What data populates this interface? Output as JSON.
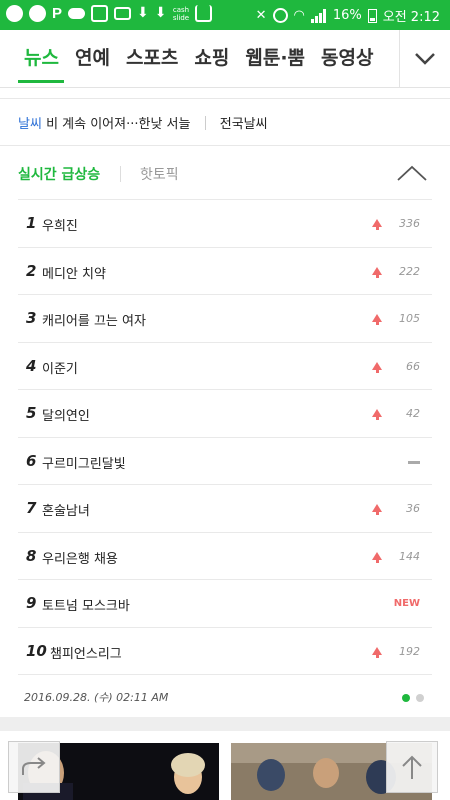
{
  "status_bar": {
    "battery": "16%",
    "time": "오전 2:12",
    "icons": [
      "chat-icon",
      "messenger-icon",
      "p-icon",
      "cloud-icon",
      "image-icon",
      "mail-icon",
      "download-icon",
      "download-icon",
      "cashslide-icon",
      "download-box-icon",
      "mute-icon",
      "alarm-icon",
      "wifi-icon",
      "signal-icon",
      "battery-icon"
    ],
    "cashslide_label": "cash slide"
  },
  "nav": {
    "tabs": [
      {
        "label": "뉴스",
        "active": true
      },
      {
        "label": "연예"
      },
      {
        "label": "스포츠"
      },
      {
        "label": "쇼핑"
      },
      {
        "label": "웹툰·뿜"
      },
      {
        "label": "동영상"
      }
    ],
    "more_icon": "chevron-down-icon",
    "accent": "#1fb83e"
  },
  "weather": {
    "label": "날씨",
    "text": "비 계속 이어져···한낮 서늘",
    "link": "전국날씨"
  },
  "realtime": {
    "tab_active": "실시간 급상승",
    "tab_other": "핫토픽",
    "collapse_icon": "chevron-up-icon",
    "items": [
      {
        "rank": "1",
        "keyword": "우희진",
        "trend": "up",
        "value": "336"
      },
      {
        "rank": "2",
        "keyword": "메디안 치약",
        "trend": "up",
        "value": "222"
      },
      {
        "rank": "3",
        "keyword": "캐리어를 끄는 여자",
        "trend": "up",
        "value": "105"
      },
      {
        "rank": "4",
        "keyword": "이준기",
        "trend": "up",
        "value": "66"
      },
      {
        "rank": "5",
        "keyword": "달의연인",
        "trend": "up",
        "value": "42"
      },
      {
        "rank": "6",
        "keyword": "구르미그린달빛",
        "trend": "same",
        "value": ""
      },
      {
        "rank": "7",
        "keyword": "혼술남녀",
        "trend": "up",
        "value": "36"
      },
      {
        "rank": "8",
        "keyword": "우리은행 채용",
        "trend": "up",
        "value": "144"
      },
      {
        "rank": "9",
        "keyword": "토트넘 모스크바",
        "trend": "new",
        "value": "NEW"
      },
      {
        "rank": "10",
        "keyword": "챔피언스리그",
        "trend": "up",
        "value": "192"
      }
    ],
    "timestamp": "2016.09.28. (수) 02:11 AM",
    "page_dots": 2,
    "active_dot": 1
  },
  "floating": {
    "share_icon": "share-arrow-icon",
    "top_icon": "scroll-top-icon"
  },
  "colors": {
    "green": "#1fb83e",
    "up": "#f06a6a",
    "weather_link": "#2b6fd6"
  }
}
